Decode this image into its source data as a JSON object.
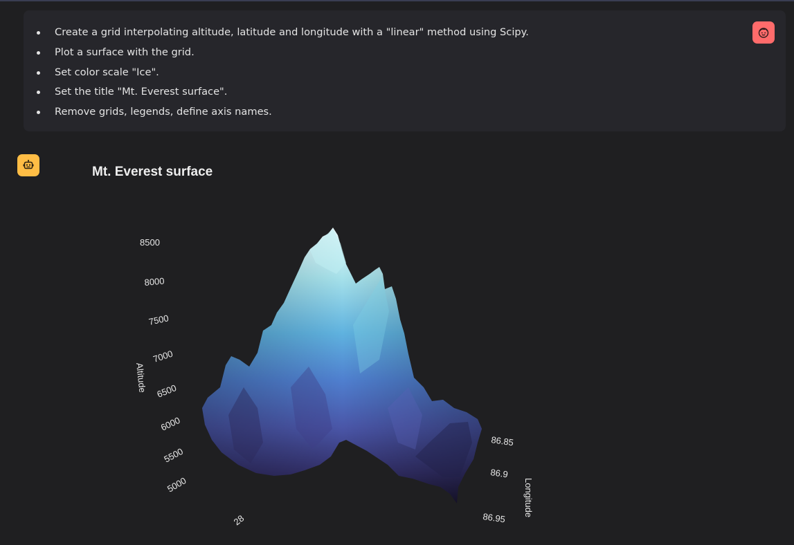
{
  "user_message": {
    "items": [
      "Create a grid interpolating altitude, latitude and longitude with a \"linear\" method using Scipy.",
      "Plot a surface with the grid.",
      "Set color scale \"Ice\".",
      "Set the title \"Mt. Everest surface\".",
      "Remove grids, legends, define axis names."
    ]
  },
  "icons": {
    "user_avatar": "user-face-icon",
    "assistant_avatar": "robot-icon"
  },
  "colors": {
    "user_avatar": "#ff6b6b",
    "assistant_avatar": "#ffbd45",
    "background": "#1f1f21"
  },
  "chart_data": {
    "type": "surface",
    "title": "Mt. Everest surface",
    "colorscale": "Ice",
    "grid": false,
    "legend": false,
    "axes": {
      "altitude": {
        "label": "Altitude",
        "ticks": [
          "8500",
          "8000",
          "7500",
          "7000",
          "6500",
          "6000",
          "5500",
          "5000"
        ]
      },
      "longitude": {
        "label": "Longitude",
        "ticks": [
          "86.85",
          "86.9",
          "86.95"
        ]
      },
      "latitude": {
        "label": "",
        "ticks": [
          "28"
        ]
      }
    },
    "peak_altitude_approx": 8700,
    "min_altitude_approx": 5000
  }
}
